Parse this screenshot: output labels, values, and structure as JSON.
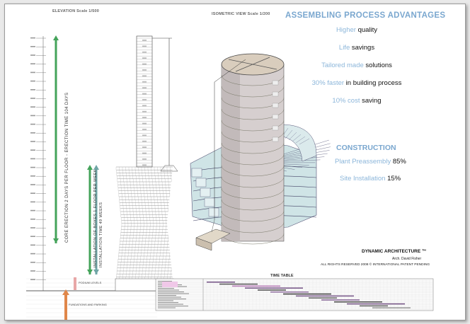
{
  "headers": {
    "elevation": "ELEVATION   Scale 1/500",
    "isometric": "ISOMETRIC VIEW  Scale 1/200"
  },
  "advantages": {
    "title": "ASSEMBLING PROCESS ADVANTAGES",
    "items": [
      {
        "highlight": "Higher",
        "text": " quality"
      },
      {
        "highlight": "Life",
        "text": " savings"
      },
      {
        "highlight": "Tailored made",
        "text": " solutions"
      },
      {
        "highlight": "30% faster",
        "text": " in building process"
      },
      {
        "highlight": "10% cost",
        "text": " saving"
      }
    ]
  },
  "construction": {
    "title": "CONSTRUCTION",
    "items": [
      {
        "highlight": "Plant Preassembly",
        "text": " 85%"
      },
      {
        "highlight": "Site Installation",
        "text": " 15%"
      }
    ]
  },
  "elevation_labels": {
    "core": "CORE ERECTION 2 DAYS PER FLOOR  -  ERECTION TIME 104 DAYS",
    "boxes_1": "INSTALLATION OF BOXES 1 FLOOR PER WEEK",
    "boxes_2": "INSTALLATION TIME 49 WEEKS",
    "podium": "PODIUM LEVELS",
    "foundations": "FUNDATIONS AND PARKING"
  },
  "credits": {
    "title": "DYNAMIC ARCHITECTURE ™",
    "architect": "Arch. David Fisher",
    "rights": "ALL RIGHTS RESERVED 2008 © INTERNATIONAL PATENT PENDING"
  },
  "timetable": {
    "title": "TIME TABLE"
  },
  "colors": {
    "accent_blue": "#7aa7cf",
    "arrow_green": "#44a35a",
    "arrow_teal": "#6fa5a5",
    "arrow_orange": "#e0874a",
    "glass": "#cfe4e6"
  }
}
